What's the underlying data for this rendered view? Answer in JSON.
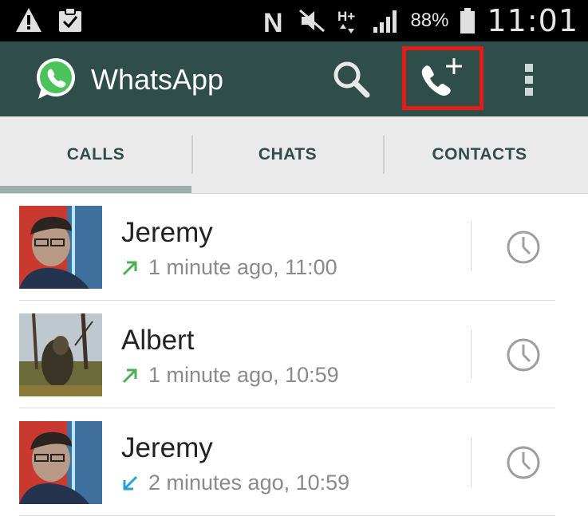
{
  "status_bar": {
    "battery_percent": "88%",
    "time": "11:01",
    "icons": [
      "warning-icon",
      "clipboard-icon",
      "nfc-icon",
      "mute-icon",
      "hplus-data-icon",
      "signal-icon",
      "battery-icon"
    ]
  },
  "app_bar": {
    "title": "WhatsApp",
    "actions": [
      "search-icon",
      "new-call-icon",
      "overflow-menu-icon"
    ],
    "highlight_color": "#e21b1b",
    "background_color": "#2f4d49"
  },
  "tabs": [
    {
      "label": "CALLS",
      "selected": true
    },
    {
      "label": "CHATS",
      "selected": false
    },
    {
      "label": "CONTACTS",
      "selected": false
    }
  ],
  "calls": [
    {
      "name": "Jeremy",
      "detail": "1 minute ago, 11:00",
      "direction": "outgoing",
      "arrow_color": "#4caf50"
    },
    {
      "name": "Albert",
      "detail": "1 minute ago, 10:59",
      "direction": "outgoing",
      "arrow_color": "#4caf50"
    },
    {
      "name": "Jeremy",
      "detail": "2 minutes ago, 10:59",
      "direction": "incoming",
      "arrow_color": "#2a9fd6"
    }
  ]
}
